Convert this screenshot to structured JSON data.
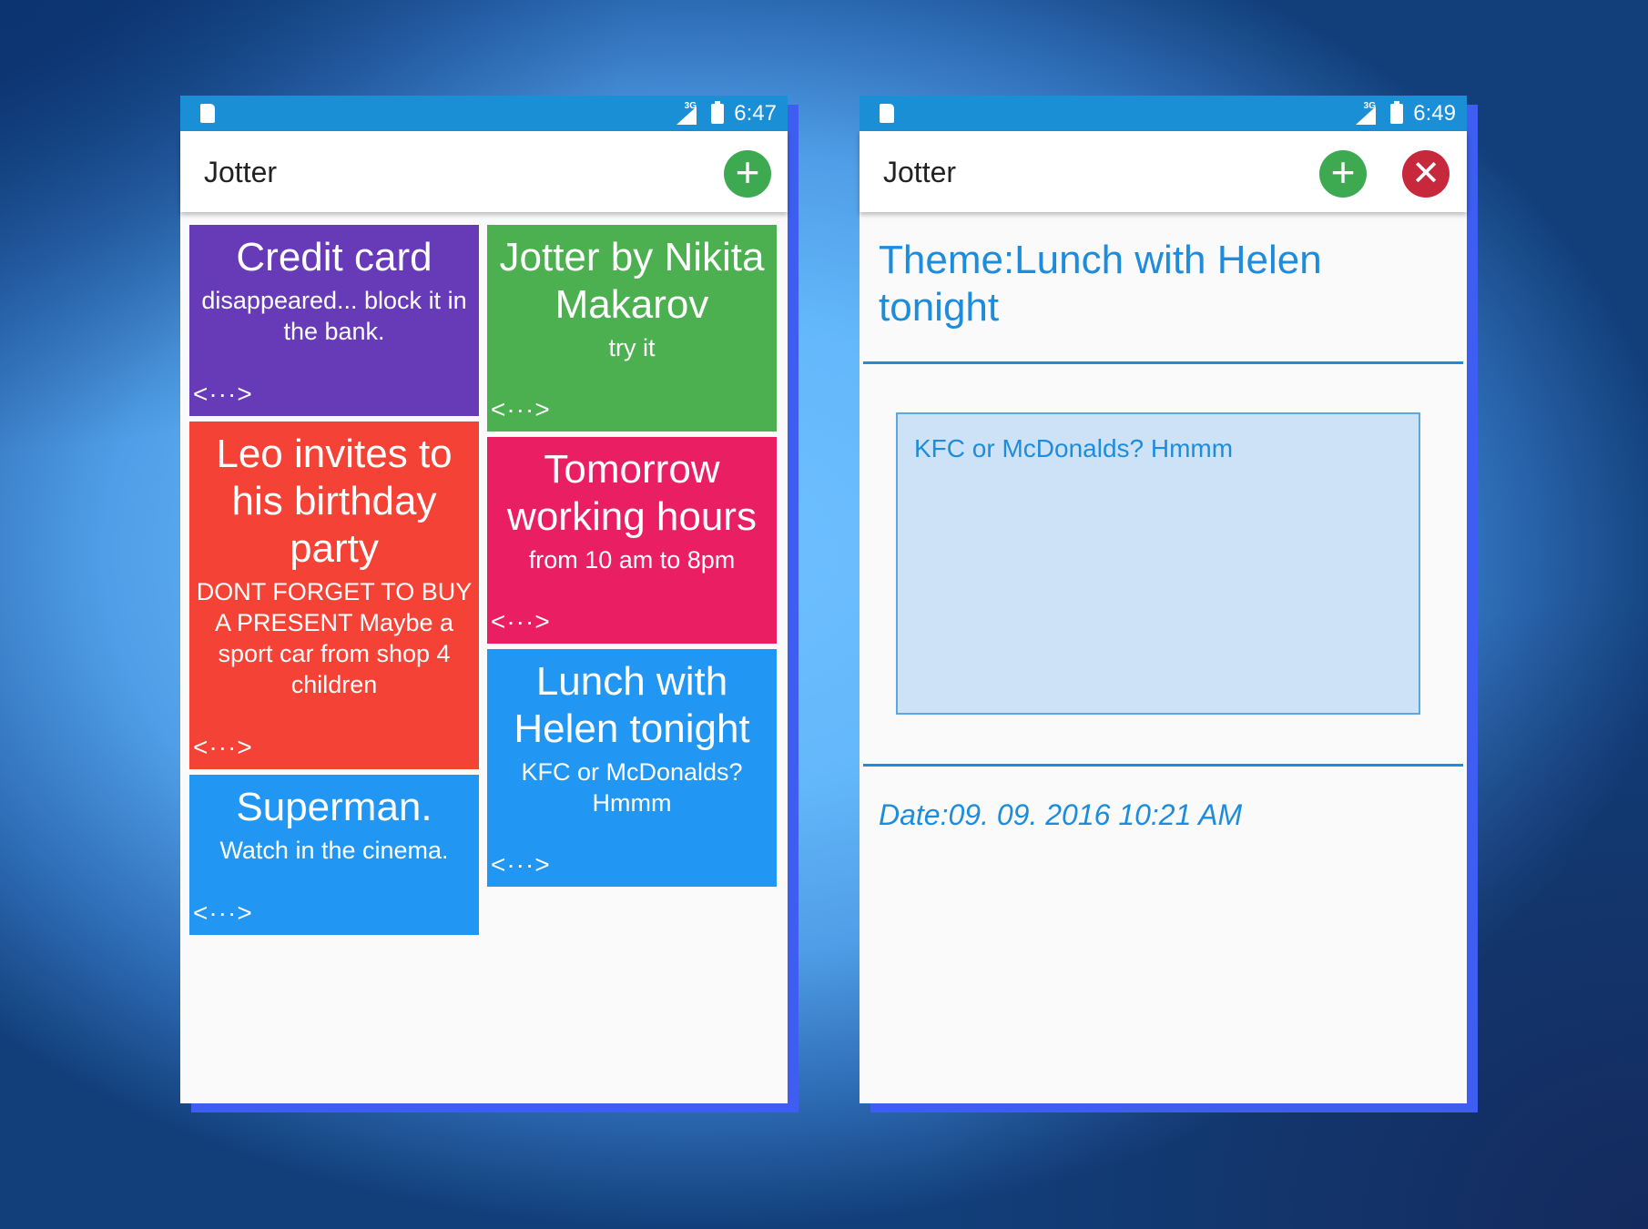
{
  "colors": {
    "statusbar": "#1a8fd6",
    "accent": "#1e8cdd",
    "add_fab": "#3daa52",
    "close_fab": "#c8283c",
    "note_purple": "#673ab7",
    "note_green": "#4caf50",
    "note_red": "#f44336",
    "note_pink": "#e91e63",
    "note_blue": "#2196f3"
  },
  "screen_list": {
    "status": {
      "network": "3G",
      "time": "6:47"
    },
    "app_title": "Jotter",
    "add_icon": "plus-icon",
    "notes": [
      {
        "title": "Credit card",
        "body": "disappeared... block it in the bank.",
        "more": "<···>",
        "color": "#673ab7"
      },
      {
        "title": "Jotter by Nikita Makarov",
        "body": "try it",
        "more": "<···>",
        "color": "#4caf50"
      },
      {
        "title": "Leo invites to his birthday party",
        "body": "DONT FORGET TO BUY A PRESENT Maybe a sport car from shop 4 children",
        "more": "<···>",
        "color": "#f44336"
      },
      {
        "title": "Tomorrow working hours",
        "body": "from 10 am to 8pm",
        "more": "<···>",
        "color": "#e91e63"
      },
      {
        "title": "Lunch with Helen tonight",
        "body": "KFC or McDonalds? Hmmm",
        "more": "<···>",
        "color": "#2196f3"
      },
      {
        "title": "Superman.",
        "body": "Watch in the cinema.",
        "more": "<···>",
        "color": "#2196f3"
      }
    ]
  },
  "screen_detail": {
    "status": {
      "network": "3G",
      "time": "6:49"
    },
    "app_title": "Jotter",
    "add_icon": "plus-icon",
    "close_icon": "close-icon",
    "theme": "Theme:Lunch with Helen tonight",
    "text": "KFC or McDonalds? Hmmm",
    "date": "Date:09. 09. 2016 10:21 AM"
  }
}
